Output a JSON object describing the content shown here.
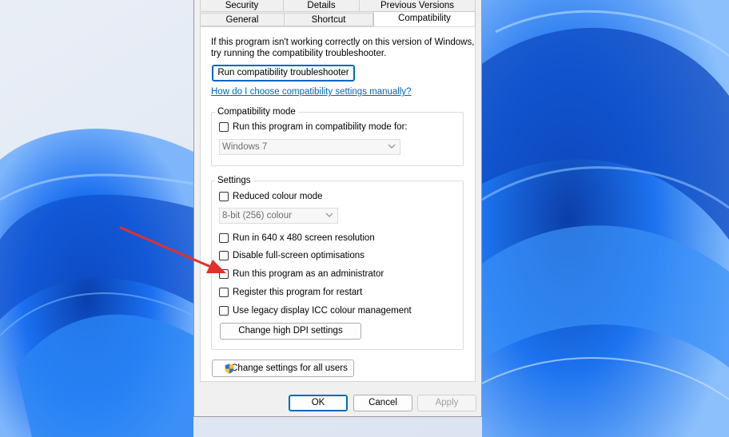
{
  "tabs_row1": [
    {
      "label": "Security"
    },
    {
      "label": "Details"
    },
    {
      "label": "Previous Versions"
    }
  ],
  "tabs_row2": [
    {
      "label": "General"
    },
    {
      "label": "Shortcut"
    },
    {
      "label": "Compatibility",
      "active": true
    }
  ],
  "intro_text_line1": "If this program isn't working correctly on this version of Windows,",
  "intro_text_line2": "try running the compatibility troubleshooter.",
  "troubleshooter_button": "Run compatibility troubleshooter",
  "help_link": "How do I choose compatibility settings manually?",
  "compat_mode": {
    "title": "Compatibility mode",
    "checkbox_label": "Run this program in compatibility mode for:",
    "checked": false,
    "select_value": "Windows 7"
  },
  "settings": {
    "title": "Settings",
    "reduced_colour_label": "Reduced colour mode",
    "colour_select_value": "8-bit (256) colour",
    "options": [
      {
        "label": "Run in 640 x 480 screen resolution",
        "checked": false
      },
      {
        "label": "Disable full-screen optimisations",
        "checked": false
      },
      {
        "label": "Run this program as an administrator",
        "checked": false
      },
      {
        "label": "Register this program for restart",
        "checked": false
      },
      {
        "label": "Use legacy display ICC colour management",
        "checked": false
      }
    ],
    "dpi_button": "Change high DPI settings"
  },
  "all_users_button": "Change settings for all users",
  "footer": {
    "ok": "OK",
    "cancel": "Cancel",
    "apply": "Apply"
  },
  "colors": {
    "arrow": "#e0312b",
    "link": "#0066cc",
    "wallpaper_base": "#1e6fe6"
  }
}
